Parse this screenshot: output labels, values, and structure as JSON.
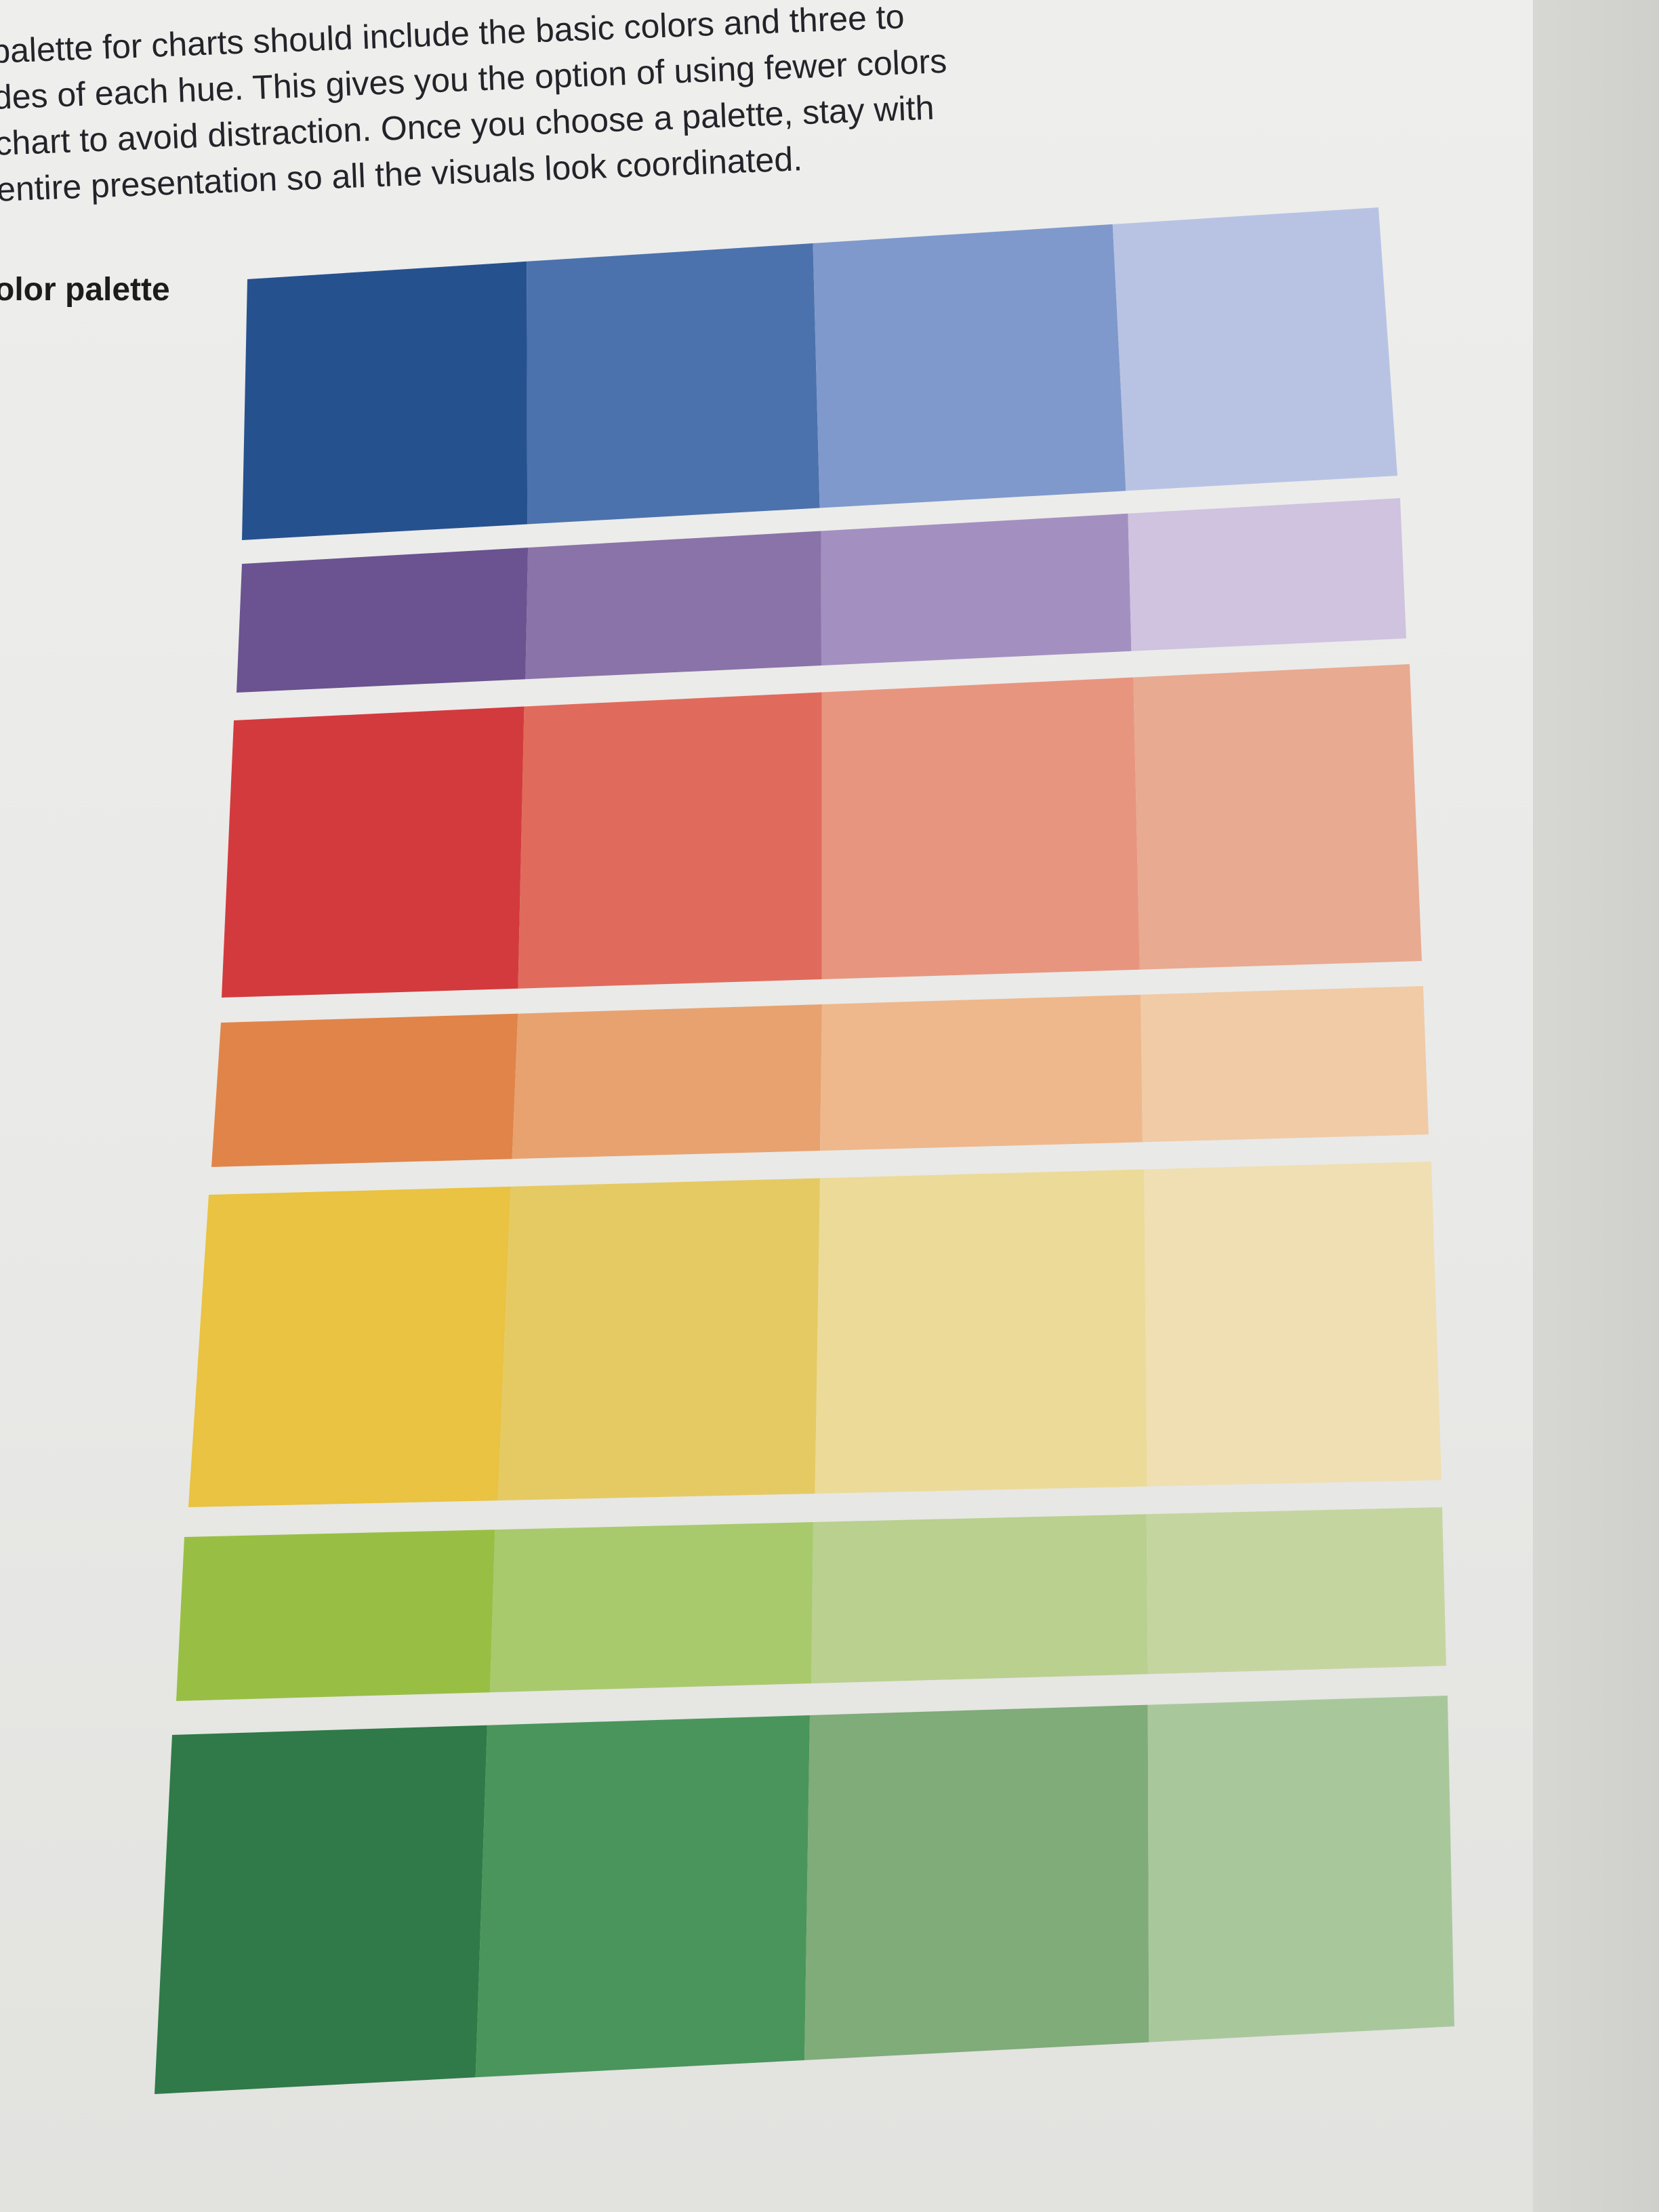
{
  "document": {
    "paragraph_lines": [
      "palette for charts should include the basic colors and three to",
      "des of each hue. This gives you the option of using fewer colors",
      "chart to avoid distraction. Once you choose a palette, stay with",
      "entire presentation so all the visuals look coordinated."
    ],
    "caption": "olor palette"
  },
  "palette": [
    {
      "hue": "blue",
      "swatches": [
        "#26518f",
        "#4b72ad",
        "#7f99cc",
        "#b8c3e4"
      ]
    },
    {
      "hue": "purple",
      "swatches": [
        "#6a5390",
        "#8a73a8",
        "#a390c1",
        "#cfc3e0"
      ]
    },
    {
      "hue": "red",
      "swatches": [
        "#d33a3e",
        "#e06b5c",
        "#e8957f",
        "#e8aa91"
      ]
    },
    {
      "hue": "orange",
      "swatches": [
        "#e0844a",
        "#e8a26f",
        "#eeb88c",
        "#f0cba6"
      ]
    },
    {
      "hue": "yellow",
      "swatches": [
        "#e9c341",
        "#e5ca64",
        "#ecda98",
        "#efdfb2"
      ]
    },
    {
      "hue": "lime",
      "swatches": [
        "#98bf43",
        "#a8ca6c",
        "#b9d08f",
        "#c5d5a0"
      ]
    },
    {
      "hue": "green",
      "swatches": [
        "#2f7a48",
        "#4a955b",
        "#7fac79",
        "#a8c89c"
      ]
    }
  ]
}
